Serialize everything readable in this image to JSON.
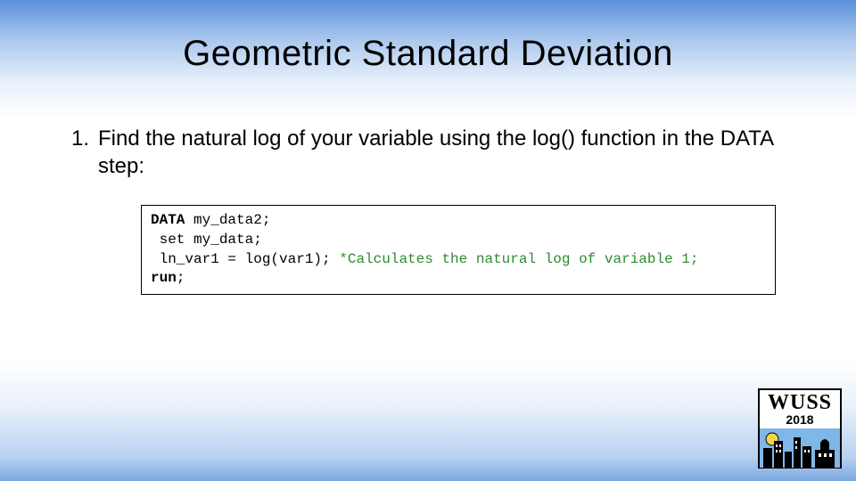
{
  "title": "Geometric Standard Deviation",
  "list": {
    "number": "1.",
    "text": "Find the natural log of your variable using the log() function in the DATA step:"
  },
  "code": {
    "l1_kw": "DATA",
    "l1_rest": " my_data2;",
    "l2": " set my_data;",
    "l3a": " ln_var1 = log(var1); ",
    "l3b": "*Calculates the natural log of variable 1;",
    "l4_kw": "run",
    "l4_rest": ";"
  },
  "logo": {
    "name": "WUSS",
    "year": "2018"
  }
}
